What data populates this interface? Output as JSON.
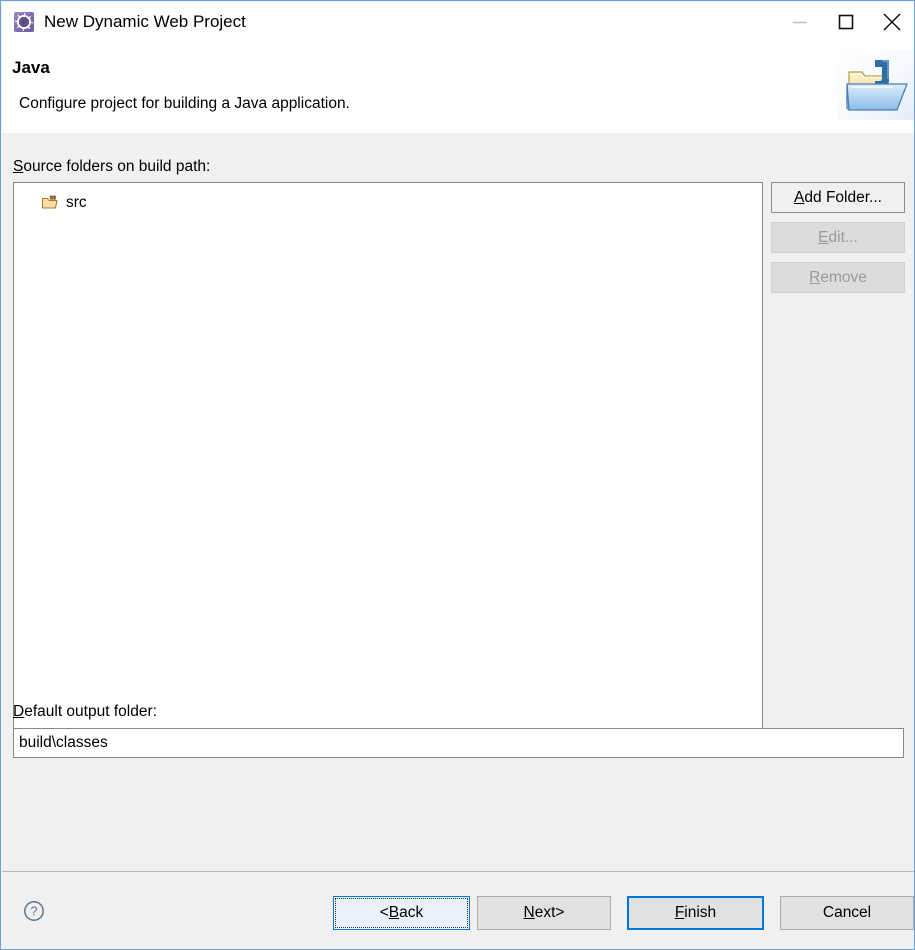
{
  "window": {
    "title": "New Dynamic Web Project",
    "icon": "eclipse-wizard-icon",
    "controls": {
      "minimize": "minimize-icon",
      "maximize": "maximize-icon",
      "close": "close-icon"
    }
  },
  "header": {
    "title": "Java",
    "description": "Configure project for building a Java application.",
    "banner_icon": "java-project-folder-icon"
  },
  "body": {
    "source_label_mnemonic": "S",
    "source_label_rest": "ource folders on build path:",
    "list": {
      "items": [
        {
          "icon": "source-folder-icon",
          "label": "src"
        }
      ]
    },
    "side_buttons": [
      {
        "mnemonic": "A",
        "rest": "dd Folder...",
        "state": "enabled"
      },
      {
        "mnemonic": "E",
        "rest": "dit...",
        "state": "disabled"
      },
      {
        "mnemonic": "R",
        "rest": "emove",
        "state": "disabled"
      }
    ],
    "output_label_mnemonic": "D",
    "output_label_rest": "efault output folder:",
    "output_value": "build\\classes",
    "output_placeholder": ""
  },
  "footer": {
    "help_icon": "help-question-icon",
    "buttons": [
      {
        "name": "back",
        "prefix": "< ",
        "mnemonic": "B",
        "rest": "ack",
        "suffix": "",
        "state": "focused",
        "width": 137
      },
      {
        "name": "next",
        "prefix": "",
        "mnemonic": "N",
        "rest": "ext",
        "suffix": " >",
        "state": "normal",
        "width": 134
      },
      {
        "name": "finish",
        "prefix": "",
        "mnemonic": "F",
        "rest": "inish",
        "suffix": "",
        "state": "default",
        "width": 137
      },
      {
        "name": "cancel",
        "prefix": "",
        "mnemonic": "",
        "rest": "Cancel",
        "suffix": "",
        "state": "normal",
        "width": 134
      }
    ]
  },
  "colors": {
    "window_border": "#6fa0d8",
    "dialog_bg": "#f0f0f0",
    "header_bg": "#ffffff",
    "accent_blue": "#0078d7",
    "field_border": "#828790",
    "disabled_text": "#9a9a9a"
  }
}
